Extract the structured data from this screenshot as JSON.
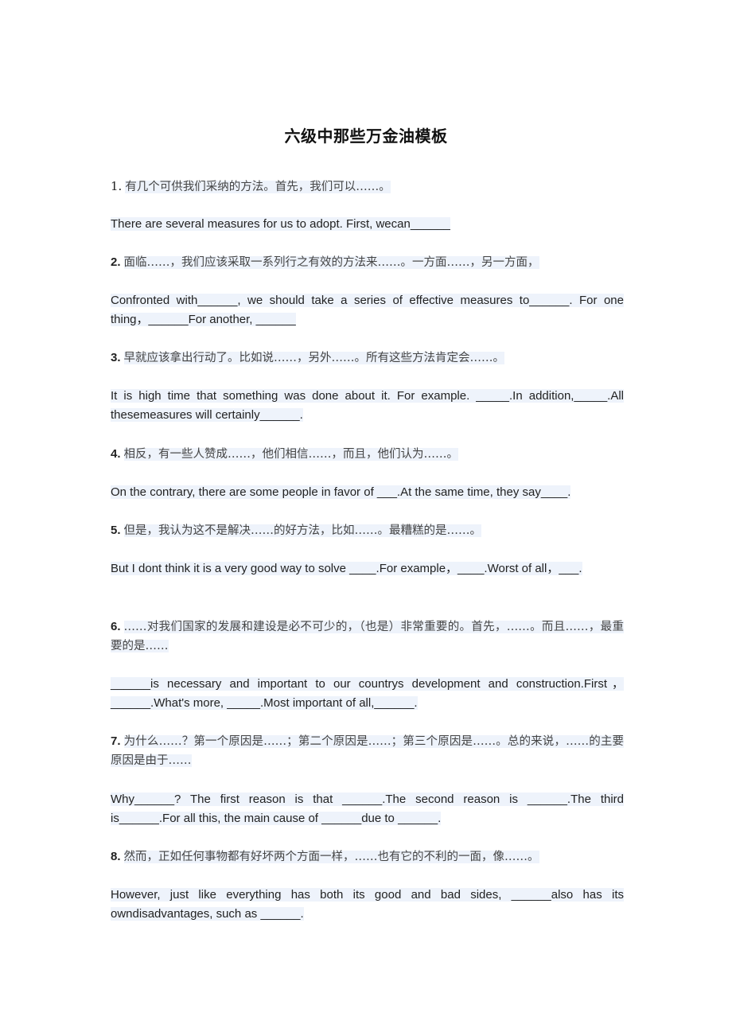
{
  "title": "六级中那些万金油模板",
  "items": [
    {
      "number": "1.",
      "cn": "有几个可供我们采纳的方法。首先，我们可以……。",
      "en": "There are several measures for us to adopt. First, wecan______"
    },
    {
      "number": "2.",
      "cn": "面临……，我们应该采取一系列行之有效的方法来……。一方面……，另一方面，",
      "en": "Confronted with______, we should take a series of effective measures to______. For one thing，______For another, ______"
    },
    {
      "number": "3.",
      "cn": "早就应该拿出行动了。比如说……，另外……。所有这些方法肯定会……。",
      "en": "It is high time that something was done about it. For example. _____.In addition,_____.All thesemeasures will certainly______."
    },
    {
      "number": "4.",
      "cn": "相反，有一些人赞成……，他们相信……，而且，他们认为……。",
      "en": "On the contrary, there are some people in favor of ___.At the same time, they say____."
    },
    {
      "number": "5.",
      "cn": "但是，我认为这不是解决……的好方法，比如……。最糟糕的是……。",
      "en": "But I dont think it is a very good way to solve ____.For example，____.Worst of all，___."
    },
    {
      "number": "6.",
      "cn": "……对我们国家的发展和建设是必不可少的，（也是）非常重要的。首先，……。而且……，最重要的是……",
      "en": "______is necessary and important to our countrys development and construction.First，______.What's more, _____.Most important of all,______."
    },
    {
      "number": "7.",
      "cn": "为什么……？第一个原因是……；第二个原因是……；第三个原因是……。总的来说，……的主要原因是由于……",
      "en": "Why______? The first reason is that ______.The second reason is ______.The third is______.For all this, the main cause of ______due to ______."
    },
    {
      "number": "8.",
      "cn": "然而，正如任何事物都有好坏两个方面一样，……也有它的不利的一面，像……。",
      "en": "However, just like everything has both its good and bad sides, ______also has its owndisadvantages, such as ______."
    }
  ]
}
